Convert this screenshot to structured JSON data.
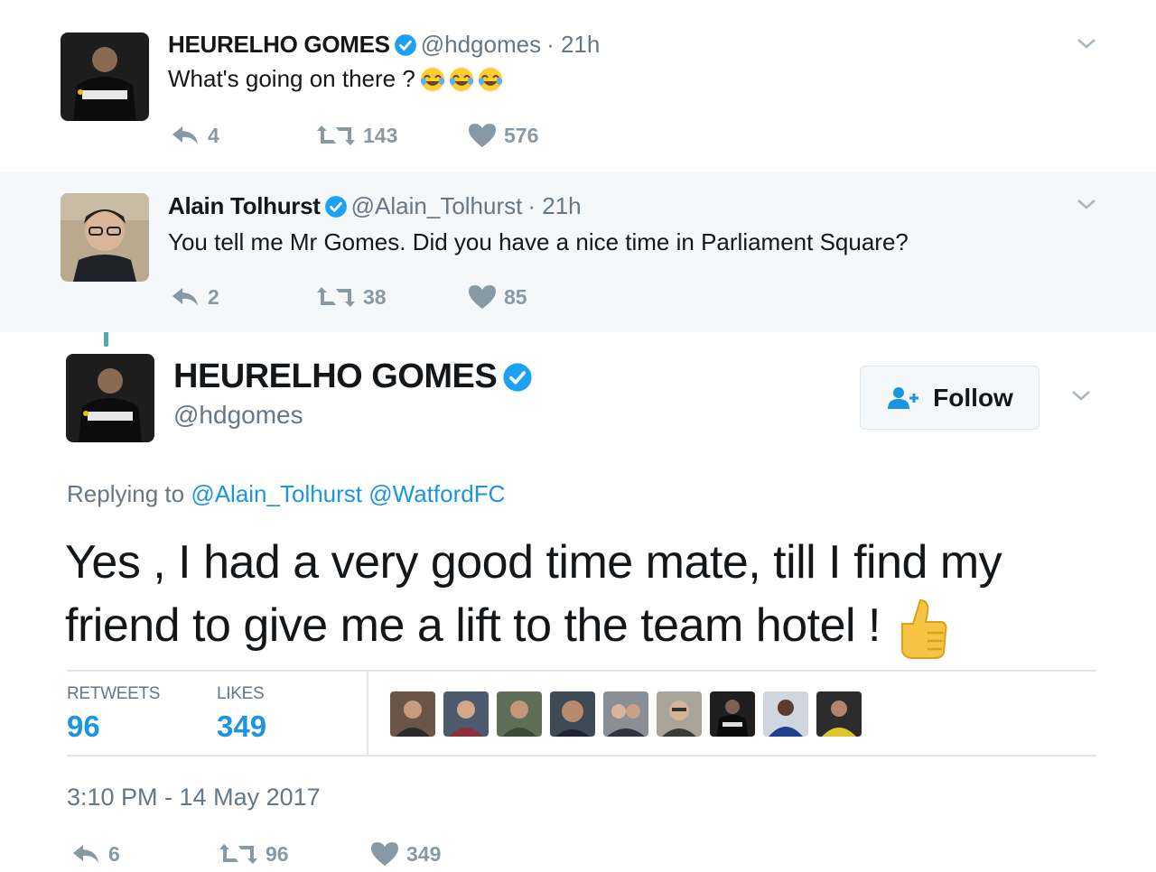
{
  "tweets": [
    {
      "name": "HEURELHO GOMES",
      "handle": "@hdgomes",
      "time": "· 21h",
      "text": "What's going on there ?",
      "emoji_count": 3,
      "replies": "4",
      "retweets": "143",
      "likes": "576"
    },
    {
      "name": "Alain Tolhurst",
      "handle": "@Alain_Tolhurst",
      "time": "· 21h",
      "text": "You tell me Mr Gomes. Did you have a nice time in Parliament Square?",
      "replies": "2",
      "retweets": "38",
      "likes": "85"
    }
  ],
  "main": {
    "name": "HEURELHO GOMES",
    "handle": "@hdgomes",
    "follow_label": "Follow",
    "replying_prefix": "Replying to",
    "mention_1": "@Alain_Tolhurst",
    "mention_2": "@WatfordFC",
    "text_line_1": "Yes , I had a very good time mate, till I find my",
    "text_line_2": "friend to give me a lift to the team hotel !",
    "retweets_label": "RETWEETS",
    "retweets_value": "96",
    "likes_label": "LIKES",
    "likes_value": "349",
    "timestamp": "3:10 PM - 14 May 2017",
    "replies": "6",
    "action_retweets": "96",
    "action_likes": "349",
    "liker_avatars_count": 9
  },
  "colors": {
    "accent": "#1b95e0",
    "thread_line": "#53a9a7",
    "muted": "#657786",
    "action_gray": "#8899a6",
    "highlight_bg": "#f5f8fa"
  },
  "icons": [
    "reply-icon",
    "retweet-icon",
    "heart-icon",
    "verified-icon",
    "chevron-down-icon",
    "follow-person-icon",
    "laughing-emoji-icon",
    "thumbs-up-emoji-icon"
  ]
}
